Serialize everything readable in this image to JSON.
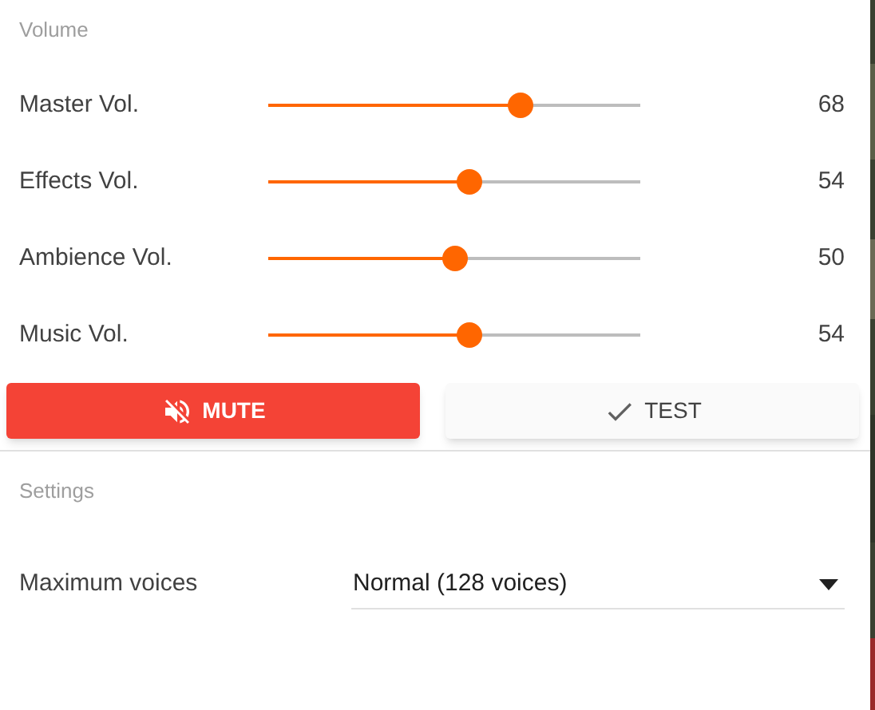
{
  "volume": {
    "title": "Volume",
    "sliders": [
      {
        "label": "Master Vol.",
        "level": 0.68,
        "reading": "68"
      },
      {
        "label": "Effects Vol.",
        "level": 0.54,
        "reading": "54"
      },
      {
        "label": "Ambience Vol.",
        "level": 0.5,
        "reading": "50"
      },
      {
        "label": "Music Vol.",
        "level": 0.54,
        "reading": "54"
      }
    ],
    "buttons": [
      {
        "kind": "mute",
        "label": "MUTE"
      },
      {
        "kind": "test",
        "label": "TEST"
      }
    ]
  },
  "settings": {
    "title": "Settings",
    "fields": [
      {
        "label": "Maximum voices",
        "value": "Normal (128 voices)"
      }
    ]
  }
}
